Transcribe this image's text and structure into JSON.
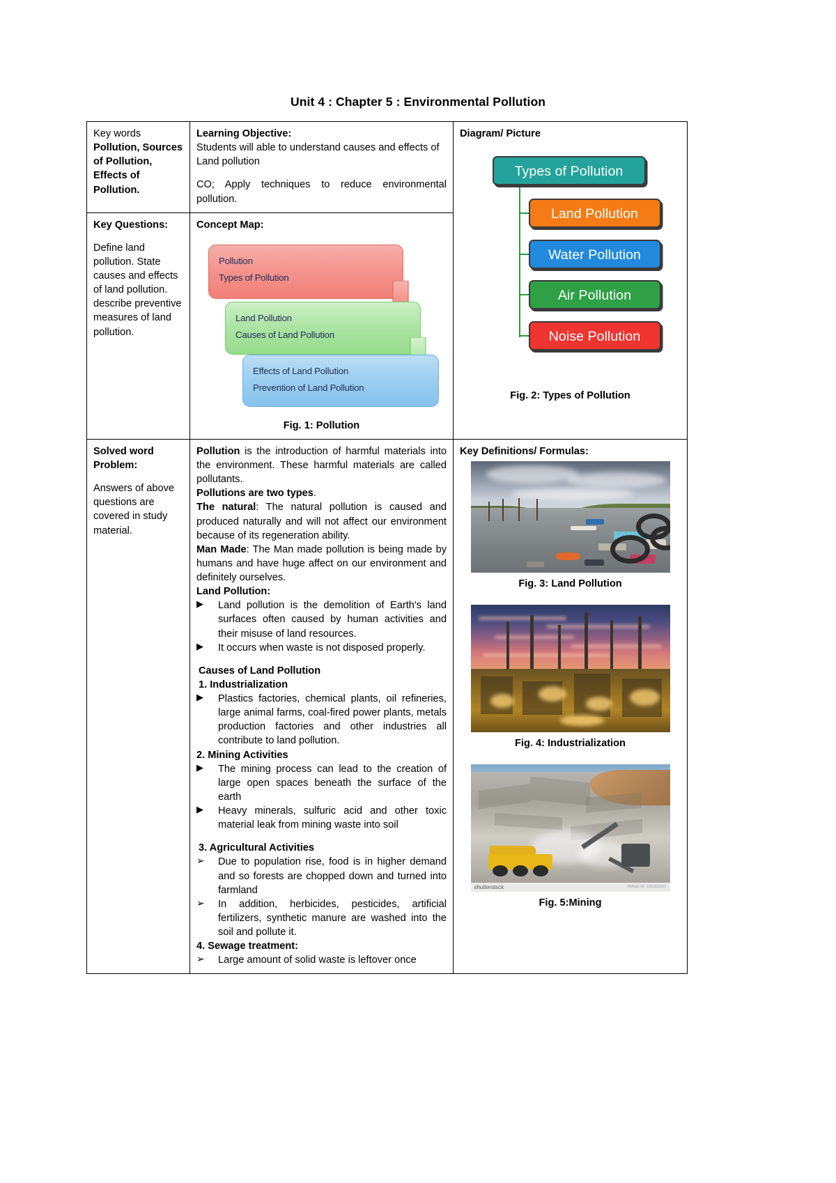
{
  "document": {
    "title": "Unit 4 : Chapter 5 : Environmental Pollution"
  },
  "row1": {
    "keywords_label": "Key words",
    "keywords_value": "Pollution, Sources of Pollution, Effects of Pollution.",
    "objective_label": "Learning Objective:",
    "objective_text": "Students will able to understand causes and effects of Land pollution",
    "co_text": "CO; Apply techniques to reduce environmental pollution.",
    "diagram_label": "Diagram/ Picture"
  },
  "row2": {
    "key_questions_label": "Key Questions:",
    "key_questions_text": "Define land pollution. State causes and effects of land pollution. describe preventive measures of land pollution.",
    "concept_map_label": "Concept Map:",
    "fig1_caption": "Fig. 1: Pollution",
    "fig2_caption": "Fig. 2: Types of Pollution"
  },
  "concept_map": {
    "boxes": [
      {
        "color": "#F08077",
        "lines": [
          "Pollution",
          "Types of Pollution"
        ]
      },
      {
        "color": "#96DC8C",
        "lines": [
          "Land Pollution",
          "Causes of Land Pollution"
        ]
      },
      {
        "color": "#86C2EC",
        "lines": [
          "Effects of Land Pollution",
          "Prevention of Land Pollution"
        ]
      }
    ]
  },
  "types_diagram": {
    "root": {
      "label": "Types of Pollution",
      "color": "#23A39B"
    },
    "children": [
      {
        "label": "Land Pollution",
        "color": "#F47B16"
      },
      {
        "label": "Water Pollution",
        "color": "#2289DC"
      },
      {
        "label": "Air Pollution",
        "color": "#2FA046"
      },
      {
        "label": "Noise Pollution",
        "color": "#F0342F"
      }
    ],
    "connector_color": "#2B9B3B"
  },
  "row3": {
    "solved_label": "Solved word Problem:",
    "solved_text": "Answers of above questions are covered in study material.",
    "key_definitions_label": "Key Definitions/ Formulas:"
  },
  "body": {
    "p1_bold": "Pollution",
    "p1_rest": " is the introduction of harmful materials into the environment. These harmful materials are called pollutants.",
    "p2_bold": "Pollutions are two types",
    "p2_rest": ".",
    "p3_bold": "The natural",
    "p3_rest": ": The natural pollution is caused and produced naturally and will not affect our environment because of its regeneration ability.",
    "p4_bold": "Man Made",
    "p4_rest": ": The Man made pollution is being made by humans and have huge affect on our environment and definitely ourselves.",
    "land_pollution_heading": "Land Pollution:",
    "land_bullets": [
      "Land pollution is the demolition of Earth's land surfaces often caused by human activities and their misuse of land resources.",
      "It occurs when waste is not disposed properly."
    ],
    "causes_heading": "Causes of Land Pollution",
    "cause1_heading": "1. Industrialization",
    "cause1_bullets": [
      "Plastics factories, chemical plants, oil refineries, large animal farms, coal-fired power plants, metals production factories and other industries all contribute to land pollution."
    ],
    "cause2_heading": "2. Mining Activities",
    "cause2_bullets": [
      "The mining process can lead to the creation of large open spaces beneath the surface of the earth",
      "Heavy minerals, sulfuric acid and other toxic material leak from mining waste into soil"
    ],
    "cause3_heading": "3. Agricultural Activities",
    "cause3_bullets": [
      "Due to population rise, food is in higher demand and so forests are chopped down and turned into farmland",
      "In addition, herbicides, pesticides, artificial fertilizers, synthetic manure are washed into the soil and pollute it."
    ],
    "cause4_heading": "4. Sewage treatment:",
    "cause4_bullets": [
      "Large amount of solid waste is leftover once"
    ]
  },
  "figures": {
    "fig3_caption": "Fig. 3: Land Pollution",
    "fig4_caption": "Fig. 4: Industrialization",
    "fig5_caption": "Fig. 5:Mining",
    "fig5_watermark_left": "shutterstsck",
    "fig5_watermark_right": "IMAGE ID: 1011111101"
  }
}
